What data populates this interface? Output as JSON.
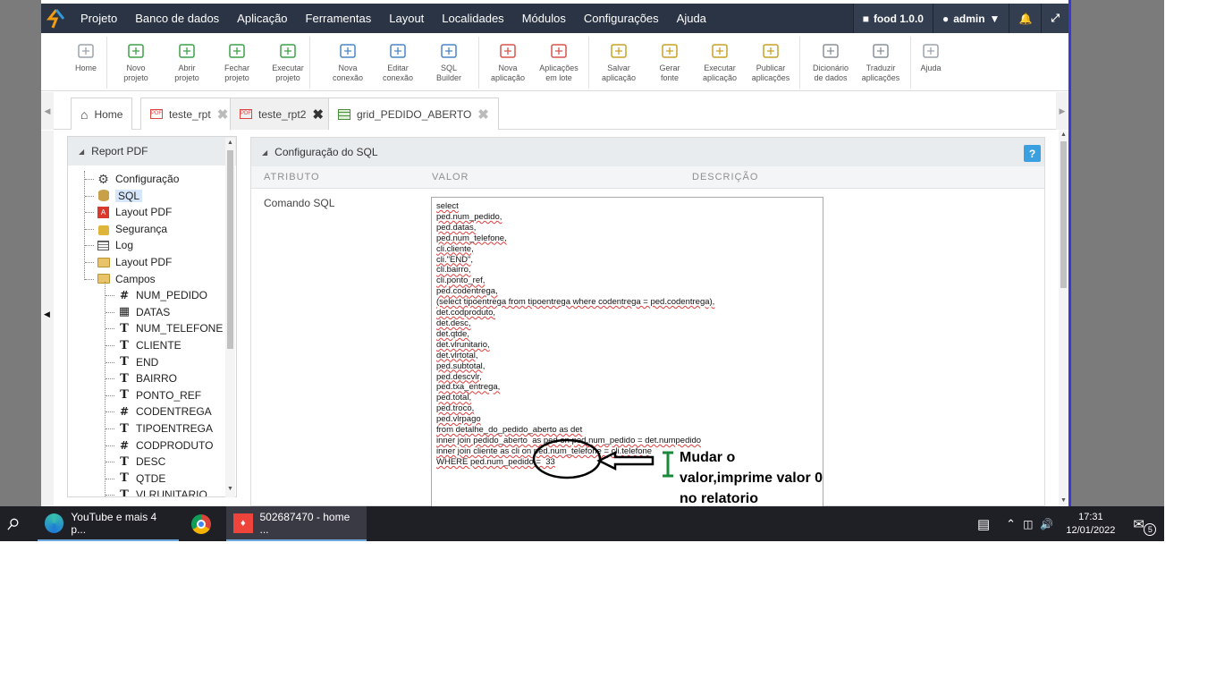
{
  "menubar": {
    "items": [
      "Projeto",
      "Banco de dados",
      "Aplicação",
      "Ferramentas",
      "Layout",
      "Localidades",
      "Módulos",
      "Configurações",
      "Ajuda"
    ],
    "project": "food 1.0.0",
    "user": "admin"
  },
  "toolbar": [
    {
      "l1": "Home",
      "l2": "",
      "icon": "home-icon"
    },
    {
      "l1": "Novo",
      "l2": "projeto",
      "icon": "new-project-icon"
    },
    {
      "l1": "Abrir",
      "l2": "projeto",
      "icon": "open-folder-icon"
    },
    {
      "l1": "Fechar",
      "l2": "projeto",
      "icon": "close-folder-icon"
    },
    {
      "l1": "Executar",
      "l2": "projeto",
      "icon": "run-folder-icon"
    },
    {
      "l1": "Nova",
      "l2": "conexão",
      "icon": "new-connection-icon"
    },
    {
      "l1": "Editar",
      "l2": "conexão",
      "icon": "edit-connection-icon"
    },
    {
      "l1": "SQL",
      "l2": "Builder",
      "icon": "sql-builder-icon"
    },
    {
      "l1": "Nova",
      "l2": "aplicação",
      "icon": "new-app-icon"
    },
    {
      "l1": "Aplicações",
      "l2": "em lote",
      "icon": "batch-apps-icon"
    },
    {
      "l1": "Salvar",
      "l2": "aplicação",
      "icon": "save-icon"
    },
    {
      "l1": "Gerar",
      "l2": "fonte",
      "icon": "gears-icon"
    },
    {
      "l1": "Executar",
      "l2": "aplicação",
      "icon": "play-icon"
    },
    {
      "l1": "Publicar",
      "l2": "aplicações",
      "icon": "cloud-upload-icon"
    },
    {
      "l1": "Dicionário",
      "l2": "de dados",
      "icon": "dictionary-icon"
    },
    {
      "l1": "Traduzir",
      "l2": "aplicações",
      "icon": "translate-icon"
    },
    {
      "l1": "Ajuda",
      "l2": "",
      "icon": "help-circle-icon"
    }
  ],
  "tabs": [
    {
      "label": "Home",
      "icon": "home-icon"
    },
    {
      "label": "teste_rpt",
      "icon": "pdf-report-icon"
    },
    {
      "label": "teste_rpt2",
      "icon": "pdf-report-icon"
    },
    {
      "label": "grid_PEDIDO_ABERTO",
      "icon": "grid-icon"
    }
  ],
  "tree": {
    "title": "Report PDF",
    "items": [
      {
        "label": "Configuração",
        "icon": "gear-icon"
      },
      {
        "label": "SQL",
        "icon": "database-icon"
      },
      {
        "label": "Layout PDF",
        "icon": "pdf-icon"
      },
      {
        "label": "Segurança",
        "icon": "lock-icon"
      },
      {
        "label": "Log",
        "icon": "log-icon"
      },
      {
        "label": "Layout PDF",
        "icon": "folder-icon"
      },
      {
        "label": "Campos",
        "icon": "folder-icon"
      }
    ],
    "fields": [
      {
        "label": "NUM_PEDIDO",
        "type": "#"
      },
      {
        "label": "DATAS",
        "type": "date"
      },
      {
        "label": "NUM_TELEFONE",
        "type": "T"
      },
      {
        "label": "CLIENTE",
        "type": "T"
      },
      {
        "label": "END",
        "type": "T"
      },
      {
        "label": "BAIRRO",
        "type": "T"
      },
      {
        "label": "PONTO_REF",
        "type": "T"
      },
      {
        "label": "CODENTREGA",
        "type": "#"
      },
      {
        "label": "TIPOENTREGA",
        "type": "T"
      },
      {
        "label": "CODPRODUTO",
        "type": "#"
      },
      {
        "label": "DESC",
        "type": "T"
      },
      {
        "label": "QTDE",
        "type": "T"
      },
      {
        "label": "VLRUNITARIO",
        "type": "T"
      }
    ]
  },
  "config": {
    "title": "Configuração do SQL",
    "help": "?",
    "col_attr": "ATRIBUTO",
    "col_value": "VALOR",
    "col_desc": "DESCRIÇÃO",
    "attr_label": "Comando SQL",
    "sql_lines": [
      "select",
      "ped.num_pedido,",
      "ped.datas,",
      "ped.num_telefone,",
      "cli.cliente,",
      "cli.\"END\",",
      "cli.bairro,",
      "cli.ponto_ref,",
      "ped.codentrega,",
      "(select tipoentrega from tipoentrega where codentrega = ped.codentrega),",
      "det.codproduto,",
      "det.desc,",
      "det.qtde,",
      "det.vlrunitario,",
      "det.vlrtotal,",
      "ped.subtotal,",
      "ped.descvlr,",
      "ped.txa_entrega,",
      "ped.total,",
      "ped.troco,",
      "ped.vlrpago",
      "from detalhe_do_pedido_aberto as det",
      "inner join pedido_aberto  as ped on ped.num_pedido = det.numpedido",
      "inner join cliente as cli on ped.num_telefone = cli.telefone",
      "WHERE ped.num_pedido =  33"
    ]
  },
  "annotation": "Mudar o\nvalor,imprime valor 0\nno relatorio",
  "taskbar": {
    "edge_label": "YouTube e mais 4 p...",
    "app_label": "502687470 - home ...",
    "time": "17:31",
    "date": "12/01/2022",
    "notif_count": "5"
  },
  "colors": {
    "menubar": "#2a3444",
    "accent": "#3aa0e0",
    "taskbar": "#1f1f26"
  }
}
